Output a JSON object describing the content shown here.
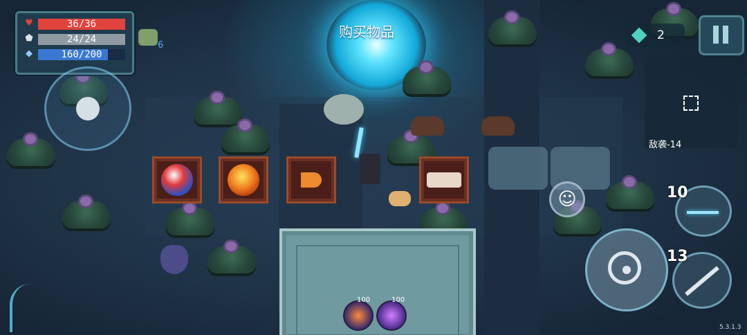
{
  "hud": {
    "hp": "36/36",
    "armor": "24/24",
    "energy": "160/200",
    "hp_fill": 1.0,
    "armor_fill": 1.0,
    "energy_fill": 0.8,
    "hp_color": "#e0443c",
    "armor_color": "#8f9aa2",
    "energy_color": "#3a78d2"
  },
  "buff": {
    "icon": "skull-buff-icon",
    "count": "6"
  },
  "gems": {
    "icon": "gem-icon",
    "count": "2"
  },
  "pause_icon": "pause-icon",
  "minimap": {
    "label": "敌袭-14",
    "icon": "expand-icon"
  },
  "shop": {
    "title": "购买物品"
  },
  "pedestals": [
    {
      "item": "red-potion-icon"
    },
    {
      "item": "orange-potion-icon"
    },
    {
      "item": "carrot-icon"
    },
    {
      "item": "meat-tray-icon"
    }
  ],
  "skills": {
    "weapon_ammo": "10",
    "blade_ammo": "13"
  },
  "consumables": [
    {
      "icon": "fire-charm-icon",
      "count": "100"
    },
    {
      "icon": "purple-charm-icon",
      "count": "100"
    }
  ],
  "emote_icon": "smile-icon",
  "version": "5.3.1.3"
}
